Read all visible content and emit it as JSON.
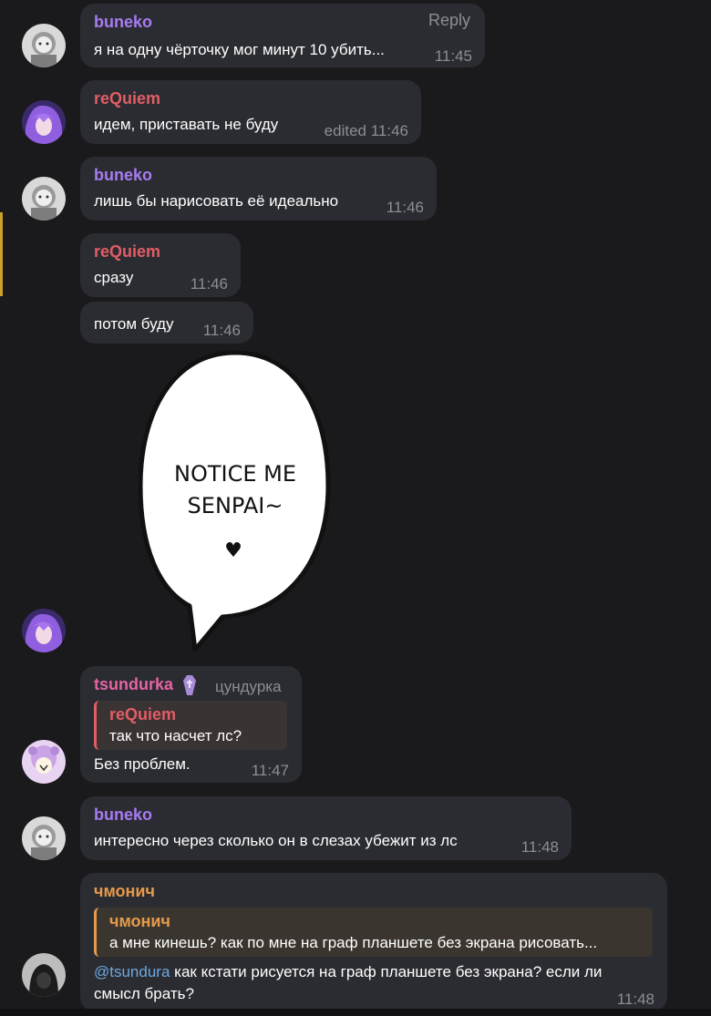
{
  "colors": {
    "background": "#1a1a1d",
    "bubble": "#2b2c31",
    "buneko": "#a77bf2",
    "requiem": "#e35d65",
    "tsundurka": "#e563a4",
    "chmonich": "#e69a4a",
    "mention": "#6ea8e0",
    "timestamp": "#8b8e95"
  },
  "messages": [
    {
      "sender": "buneko",
      "text": "я на одну чёрточку мог минут 10 убить...",
      "time": "11:45",
      "action": "Reply"
    },
    {
      "sender": "reQuiem",
      "text": "идем, приставать не буду",
      "time": "edited 11:46"
    },
    {
      "sender": "buneko",
      "text": "лишь бы нарисовать её идеально",
      "time": "11:46"
    },
    {
      "sender": "reQuiem",
      "text": "сразу",
      "time": "11:46"
    },
    {
      "text": "потом буду",
      "time": "11:46"
    },
    {
      "sticker": {
        "line1": "NOTICE ME",
        "line2": "SENPAI~",
        "heart": "♥"
      }
    },
    {
      "sender": "tsundurka",
      "badge_icon": "coffin-icon",
      "subtitle": "цундурка",
      "reply_to": {
        "sender": "reQuiem",
        "text": "так что насчет лс?"
      },
      "text": "Без проблем.",
      "time": "11:47"
    },
    {
      "sender": "buneko",
      "text": "интересно через сколько он в слезах убежит из лс",
      "time": "11:48"
    },
    {
      "sender": "чмонич",
      "reply_to": {
        "sender": "чмонич",
        "text": "а мне кинешь? как по мне на граф планшете без экрана рисовать..."
      },
      "mention": "@tsundura",
      "text_line1": " как кстати рисуется на граф планшете без экрана? если ли",
      "text_line2": "смысл брать?",
      "time": "11:48"
    }
  ]
}
